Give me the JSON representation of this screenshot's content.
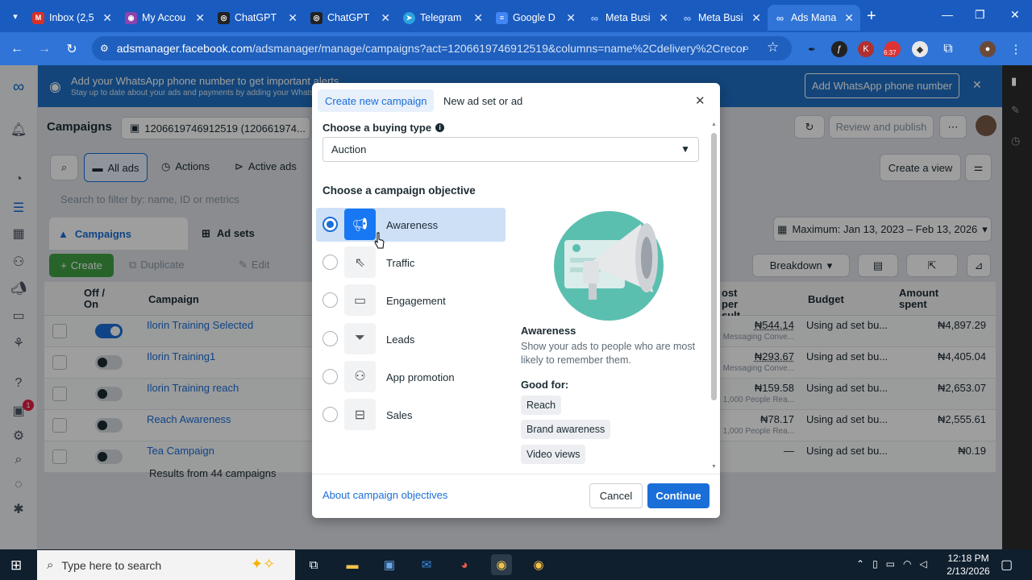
{
  "browser": {
    "tabs": [
      {
        "label": "Inbox (2,5",
        "fav": "M",
        "color": "#d93025"
      },
      {
        "label": "My Accou",
        "fav": "◉",
        "color": "#8e44ad"
      },
      {
        "label": "ChatGPT",
        "fav": "◎",
        "color": "#222222"
      },
      {
        "label": "ChatGPT",
        "fav": "◎",
        "color": "#222222"
      },
      {
        "label": "Telegram",
        "fav": "➤",
        "color": "#2aa3e0"
      },
      {
        "label": "Google D",
        "fav": "≡",
        "color": "#4285f4"
      },
      {
        "label": "Meta Busi",
        "fav": "∞",
        "color": "#0a66d9"
      },
      {
        "label": "Meta Busi",
        "fav": "∞",
        "color": "#0a66d9"
      },
      {
        "label": "Ads Mana",
        "fav": "∞",
        "color": "#0a66d9"
      }
    ],
    "url_host": "adsmanager.facebook.com",
    "url_rest": "/adsmanager/manage/campaigns?act=1206619746912519&columns=name%2Cdelivery%2Crecomme...",
    "ext_badge": "6:37"
  },
  "banner": {
    "title": "Add your WhatsApp phone number to get important alerts",
    "subtitle": "Stay up to date about your ads and payments by adding your WhatsApp",
    "button": "Add WhatsApp phone number"
  },
  "page": {
    "title": "Campaigns",
    "account": "1206619746912519 (120661974...",
    "review_publish": "Review and publish",
    "all_ads": "All ads",
    "actions": "Actions",
    "active_ads": "Active ads",
    "create_view": "Create a view",
    "search_placeholder": "Search to filter by: name, ID or metrics",
    "date_range": "Maximum: Jan 13, 2023 – Feb 13, 2026",
    "tab_campaigns": "Campaigns",
    "tab_adsets": "Ad sets",
    "create": "Create",
    "duplicate": "Duplicate",
    "edit": "Edit",
    "breakdown": "Breakdown",
    "col_offon": "Off / On",
    "col_campaign": "Campaign",
    "col_cost": "ost per sult",
    "col_budget": "Budget",
    "col_amount": "Amount spent",
    "rows": [
      {
        "name": "Ilorin Training Selected",
        "cost": "₦544.14",
        "cost_sub": "Messaging Conve...",
        "budget": "Using ad set bu...",
        "amount": "₦4,897.29"
      },
      {
        "name": "Ilorin Training1",
        "cost": "₦293.67",
        "cost_sub": "Messaging Conve...",
        "budget": "Using ad set bu...",
        "amount": "₦4,405.04"
      },
      {
        "name": "Ilorin Training reach",
        "cost": "₦159.58",
        "cost_sub": "1,000 People Rea...",
        "budget": "Using ad set bu...",
        "amount": "₦2,653.07"
      },
      {
        "name": "Reach Awareness",
        "cost": "₦78.17",
        "cost_sub": "1,000 People Rea...",
        "budget": "Using ad set bu...",
        "amount": "₦2,555.61"
      },
      {
        "name": "Tea Campaign",
        "cost": "—",
        "cost_sub": "",
        "budget": "Using ad set bu...",
        "amount": "₦0.19"
      }
    ],
    "results": "Results from 44 campaigns",
    "notif_count": "1"
  },
  "modal": {
    "tab_create": "Create new campaign",
    "tab_new": "New ad set or ad",
    "buying_label": "Choose a buying type",
    "buying_value": "Auction",
    "objective_label": "Choose a campaign objective",
    "objectives": [
      {
        "label": "Awareness",
        "icon": "megaphone-icon"
      },
      {
        "label": "Traffic",
        "icon": "cursor-icon"
      },
      {
        "label": "Engagement",
        "icon": "chat-icon"
      },
      {
        "label": "Leads",
        "icon": "filter-icon"
      },
      {
        "label": "App promotion",
        "icon": "people-icon"
      },
      {
        "label": "Sales",
        "icon": "bag-icon"
      }
    ],
    "detail_title": "Awareness",
    "detail_desc": "Show your ads to people who are most likely to remember them.",
    "good_for": "Good for:",
    "tags": [
      "Reach",
      "Brand awareness",
      "Video views"
    ],
    "about_link": "About campaign objectives",
    "cancel": "Cancel",
    "continue": "Continue"
  },
  "taskbar": {
    "search_placeholder": "Type here to search",
    "time": "12:18 PM",
    "date": "2/13/2026"
  }
}
